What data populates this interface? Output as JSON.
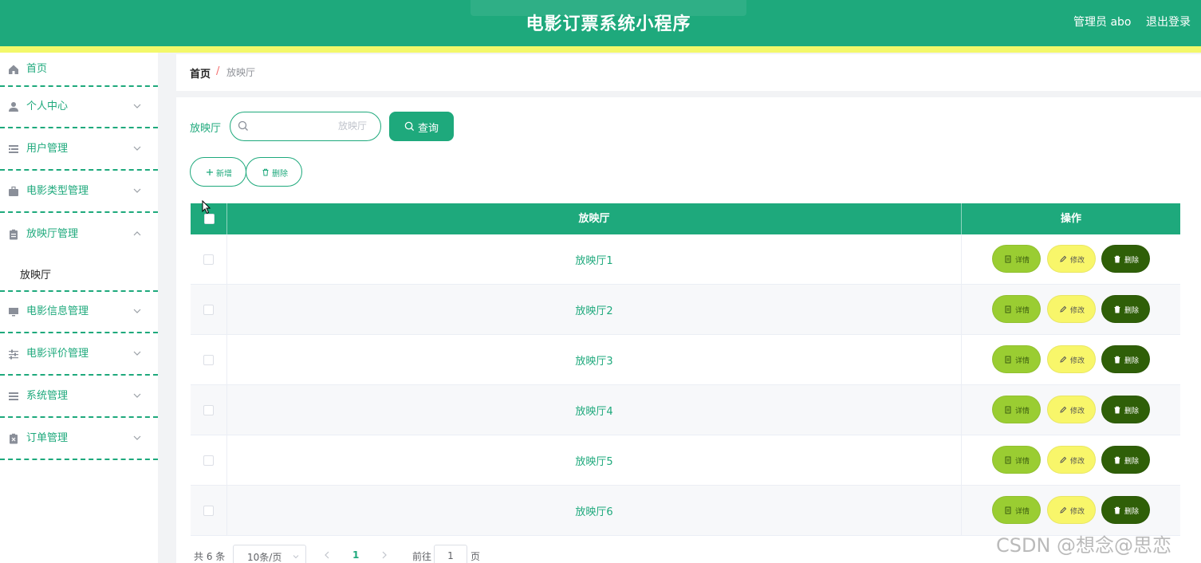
{
  "header": {
    "title": "电影订票系统小程序",
    "admin_label": "管理员 abo",
    "logout_label": "退出登录",
    "bg_color": "#1ea97c",
    "stripe_color": "#f3f86a"
  },
  "sidebar": {
    "items": [
      {
        "label": "首页",
        "icon": "home-icon",
        "expanded": false
      },
      {
        "label": "个人中心",
        "icon": "user-icon",
        "expanded": false
      },
      {
        "label": "用户管理",
        "icon": "list-icon",
        "expanded": false
      },
      {
        "label": "电影类型管理",
        "icon": "briefcase-icon",
        "expanded": false
      },
      {
        "label": "放映厅管理",
        "icon": "clipboard-icon",
        "expanded": true
      },
      {
        "label": "电影信息管理",
        "icon": "monitor-icon",
        "expanded": false
      },
      {
        "label": "电影评价管理",
        "icon": "sliders-icon",
        "expanded": false
      },
      {
        "label": "系统管理",
        "icon": "menu-icon",
        "expanded": false
      },
      {
        "label": "订单管理",
        "icon": "clipboard-x-icon",
        "expanded": false
      }
    ],
    "submenu": {
      "label": "放映厅"
    }
  },
  "breadcrumb": {
    "home": "首页",
    "separator": "/",
    "current": "放映厅"
  },
  "search": {
    "label": "放映厅",
    "placeholder": "放映厅",
    "value": "",
    "query_label": "查询"
  },
  "toolbar": {
    "add_label": "新增",
    "delete_label": "删除"
  },
  "table": {
    "columns": [
      "放映厅",
      "操作"
    ],
    "rows": [
      {
        "name": "放映厅1"
      },
      {
        "name": "放映厅2"
      },
      {
        "name": "放映厅3"
      },
      {
        "name": "放映厅4"
      },
      {
        "name": "放映厅5"
      },
      {
        "name": "放映厅6"
      }
    ],
    "actions": {
      "detail": "详情",
      "edit": "修改",
      "delete": "删除"
    }
  },
  "pagination": {
    "total_label": "共 6 条",
    "page_size_label": "10条/页",
    "current_page": "1",
    "goto_label": "前往",
    "goto_value": "1",
    "page_unit": "页"
  },
  "watermark": "CSDN @想念@思恋"
}
